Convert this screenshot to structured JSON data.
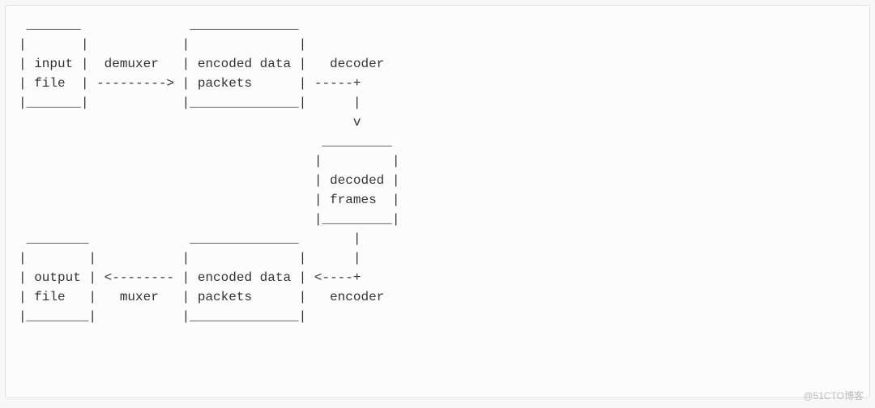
{
  "diagram": {
    "ascii": " _______              ______________\n|       |            |              |\n| input |  demuxer   | encoded data |   decoder\n| file  | ---------> | packets      | -----+\n|_______|            |______________|      |\n                                           v\n                                       _________\n                                      |         |\n                                      | decoded |\n                                      | frames  |\n                                      |_________|\n ________             ______________       |\n|        |           |              |      |\n| output | <-------- | encoded data | <----+\n| file   |   muxer   | packets      |   encoder\n|________|           |______________|"
  },
  "chart_data": {
    "type": "flow-diagram",
    "nodes": [
      {
        "id": "input_file",
        "label": "input file"
      },
      {
        "id": "encoded_in",
        "label": "encoded data packets"
      },
      {
        "id": "decoded_frames",
        "label": "decoded frames"
      },
      {
        "id": "encoded_out",
        "label": "encoded data packets"
      },
      {
        "id": "output_file",
        "label": "output file"
      }
    ],
    "edges": [
      {
        "from": "input_file",
        "to": "encoded_in",
        "label": "demuxer"
      },
      {
        "from": "encoded_in",
        "to": "decoded_frames",
        "label": "decoder"
      },
      {
        "from": "decoded_frames",
        "to": "encoded_out",
        "label": "encoder"
      },
      {
        "from": "encoded_out",
        "to": "output_file",
        "label": "muxer"
      }
    ]
  },
  "watermark": "@51CTO博客"
}
